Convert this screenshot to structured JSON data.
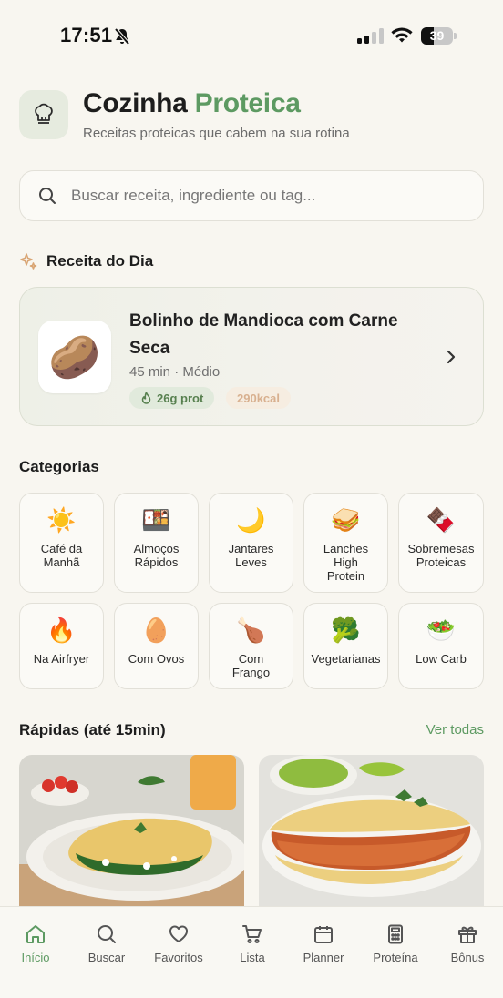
{
  "status_bar": {
    "time": "17:51",
    "battery": "39",
    "battery_level": 0.39
  },
  "header": {
    "title_part1": "Cozinha",
    "title_part2": "Proteica",
    "subtitle": "Receitas proteicas que cabem na sua rotina",
    "logo_icon": "chef-hat-icon"
  },
  "search": {
    "placeholder": "Buscar receita, ingrediente ou tag..."
  },
  "daily": {
    "section_title": "Receita do Dia",
    "name": "Bolinho de Mandioca com Carne Seca",
    "thumb": "🥔",
    "meta": "45 min · Médio",
    "protein": "26g prot",
    "kcal": "290kcal"
  },
  "categories": {
    "title": "Categorias",
    "items": [
      {
        "emoji": "☀️",
        "label": "Café da\nManhã"
      },
      {
        "emoji": "🍱",
        "label": "Almoços\nRápidos"
      },
      {
        "emoji": "🌙",
        "label": "Jantares\nLeves"
      },
      {
        "emoji": "🥪",
        "label": "Lanches\nHigh\nProtein"
      },
      {
        "emoji": "🍫",
        "label": "Sobremesas\nProteicas"
      },
      {
        "emoji": "🔥",
        "label": "Na Airfryer"
      },
      {
        "emoji": "🥚",
        "label": "Com Ovos"
      },
      {
        "emoji": "🍗",
        "label": "Com\nFrango"
      },
      {
        "emoji": "🥦",
        "label": "Vegetarianas"
      },
      {
        "emoji": "🥗",
        "label": "Low Carb"
      }
    ]
  },
  "quick": {
    "title": "Rápidas (até 15min)",
    "see_all": "Ver todas"
  },
  "nav": {
    "items": [
      {
        "label": "Início",
        "icon": "home-icon",
        "active": true
      },
      {
        "label": "Buscar",
        "icon": "search-icon"
      },
      {
        "label": "Favoritos",
        "icon": "heart-icon"
      },
      {
        "label": "Lista",
        "icon": "cart-icon"
      },
      {
        "label": "Planner",
        "icon": "calendar-icon"
      },
      {
        "label": "Proteína",
        "icon": "calculator-icon"
      },
      {
        "label": "Bônus",
        "icon": "gift-icon"
      }
    ]
  },
  "colors": {
    "accent": "#5d9a62",
    "background": "#f8f6f0"
  }
}
